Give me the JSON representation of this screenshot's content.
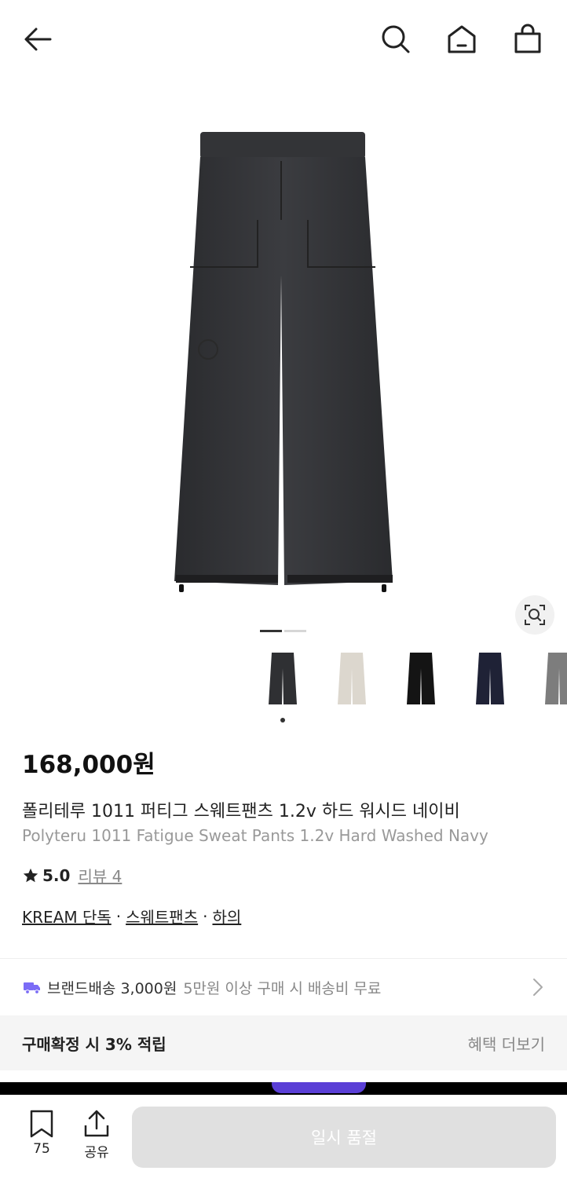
{
  "header": {
    "back_icon": "arrow-left-icon",
    "search_icon": "search-icon",
    "home_icon": "home-icon",
    "bag_icon": "shopping-bag-icon"
  },
  "gallery": {
    "image_icon": "pants-photo",
    "lens_icon": "image-search-icon",
    "page_current": 1,
    "page_total": 2
  },
  "thumbnails": [
    {
      "name": "thumb-charcoal",
      "color": "#2f3033"
    },
    {
      "name": "thumb-ivory",
      "color": "#dcd7ce"
    },
    {
      "name": "thumb-black",
      "color": "#141414"
    },
    {
      "name": "thumb-navy",
      "color": "#1f2236"
    },
    {
      "name": "thumb-grey",
      "color": "#7d7d7d"
    }
  ],
  "product": {
    "price": "168,000원",
    "title_ko": "폴리테루 1011 퍼티그 스웨트팬츠 1.2v 하드 워시드 네이비",
    "title_en": "Polyteru 1011 Fatigue Sweat Pants 1.2v Hard Washed Navy",
    "rating": "5.0",
    "review_label": "리뷰 4",
    "categories": [
      "KREAM 단독",
      "스웨트팬츠",
      "하의"
    ],
    "category_separator": "·"
  },
  "delivery": {
    "icon": "truck-icon",
    "label": "브랜드배송 3,000원",
    "note": "5만원 이상 구매 시 배송비 무료",
    "accent": "#7b6cf6"
  },
  "benefit": {
    "title": "구매확정 시 3% 적립",
    "more_label": "혜택 더보기"
  },
  "bottom_bar": {
    "bookmark_count": "75",
    "share_label": "공유",
    "purchase_label": "일시 품절"
  },
  "colors": {
    "primary_text": "#222222",
    "muted_text": "#888888",
    "disabled_button": "#e0e0e0"
  }
}
